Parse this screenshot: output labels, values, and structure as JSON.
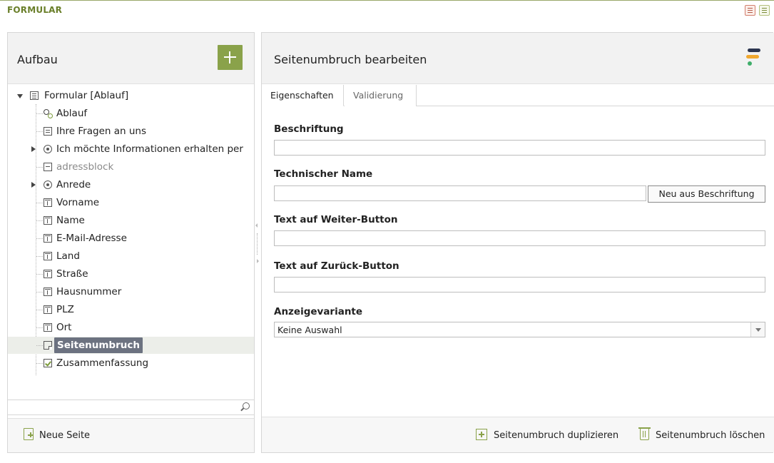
{
  "header": {
    "title": "FORMULAR",
    "icons": [
      "document-icon",
      "window-icon"
    ]
  },
  "left": {
    "title": "Aufbau",
    "add_icon": "plus-icon",
    "tree": [
      {
        "label": "Formular [Ablauf]",
        "icon": "form-icon",
        "expanded": true
      },
      {
        "label": "Ablauf",
        "icon": "flow-icon"
      },
      {
        "label": "Ihre Fragen an uns",
        "icon": "textarea-icon"
      },
      {
        "label": "Ich möchte Informationen erhalten per",
        "icon": "radio-icon",
        "collapsed": true
      },
      {
        "label": "adressblock",
        "icon": "block-icon",
        "muted": true
      },
      {
        "label": "Anrede",
        "icon": "radio-icon",
        "collapsed": true
      },
      {
        "label": "Vorname",
        "icon": "field-icon"
      },
      {
        "label": "Name",
        "icon": "field-icon"
      },
      {
        "label": "E-Mail-Adresse",
        "icon": "field-icon"
      },
      {
        "label": "Land",
        "icon": "field-icon"
      },
      {
        "label": "Straße",
        "icon": "field-icon"
      },
      {
        "label": "Hausnummer",
        "icon": "field-icon"
      },
      {
        "label": "PLZ",
        "icon": "field-icon"
      },
      {
        "label": "Ort",
        "icon": "field-icon"
      },
      {
        "label": "Seitenumbruch",
        "icon": "page-break-icon",
        "selected": true
      },
      {
        "label": "Zusammenfassung",
        "icon": "summary-icon"
      }
    ],
    "search": {
      "value": "",
      "placeholder": ""
    },
    "footer": {
      "new_page_label": "Neue Seite"
    }
  },
  "right": {
    "title": "Seitenumbruch bearbeiten",
    "tabs": [
      {
        "label": "Eigenschaften",
        "active": true
      },
      {
        "label": "Validierung",
        "active": false
      }
    ],
    "fields": {
      "beschriftung": {
        "label": "Beschriftung",
        "value": ""
      },
      "technischer_name": {
        "label": "Technischer Name",
        "value": "",
        "button": "Neu aus Beschriftung"
      },
      "weiter": {
        "label": "Text auf Weiter-Button",
        "value": ""
      },
      "zurueck": {
        "label": "Text auf Zurück-Button",
        "value": ""
      },
      "anzeigevariante": {
        "label": "Anzeigevariante",
        "selected": "Keine Auswahl"
      }
    },
    "footer": {
      "duplicate_label": "Seitenumbruch duplizieren",
      "delete_label": "Seitenumbruch löschen"
    }
  },
  "colors": {
    "accent_green": "#8aa24a",
    "header_green": "#6a7f2a",
    "selection": "#6c7280",
    "brand_navy": "#2b3550",
    "brand_orange": "#f0a830",
    "brand_green": "#3fae6a"
  }
}
